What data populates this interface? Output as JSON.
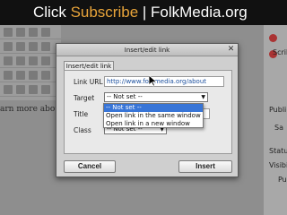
{
  "banner": {
    "prefix": "Click ",
    "subscribe": "Subscribe",
    "suffix": " | FolkMedia.org"
  },
  "background": {
    "editor_text": "arn more about u",
    "right_labels": [
      "Scrib",
      "Publi",
      "Sa",
      "Status",
      "Visibi",
      "Pu"
    ]
  },
  "dialog": {
    "title": "Insert/edit link",
    "close_icon": "close-icon",
    "tab": "Insert/edit link",
    "link_url": {
      "label": "Link URL",
      "value": "http://www.folkmedia.org/about"
    },
    "target": {
      "label": "Target",
      "selected": "-- Not set --"
    },
    "title_field": {
      "label": "Title",
      "value": ""
    },
    "class_field": {
      "label": "Class",
      "selected": "-- Not set --"
    },
    "target_options": [
      "-- Not set --",
      "Open link in the same window",
      "Open link in a new window"
    ],
    "cancel_label": "Cancel",
    "insert_label": "Insert"
  },
  "colors": {
    "banner_bg": "#111111",
    "subscribe": "#e8a43a",
    "selection": "#3875d7",
    "link_text": "#1b4f9e"
  }
}
